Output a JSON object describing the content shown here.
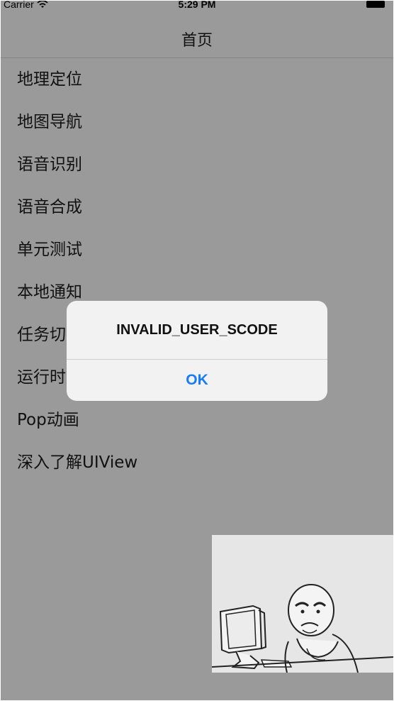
{
  "status_bar": {
    "carrier": "Carrier",
    "time": "5:29 PM",
    "wifi_icon": "wifi-icon",
    "battery_icon": "battery-icon"
  },
  "nav": {
    "title": "首页"
  },
  "menu": {
    "items": [
      {
        "label": "地理定位"
      },
      {
        "label": "地图导航"
      },
      {
        "label": "语音识别"
      },
      {
        "label": "语音合成"
      },
      {
        "label": "单元测试"
      },
      {
        "label": "本地通知"
      },
      {
        "label": "任务切换"
      },
      {
        "label": "运行时"
      },
      {
        "label": "Pop动画"
      },
      {
        "label": "深入了解UIView"
      }
    ]
  },
  "alert": {
    "title": "INVALID_USER_SCODE",
    "ok_label": "OK"
  },
  "overlay": {
    "description_icon": "meme-computer-guy-image"
  },
  "colors": {
    "background_dim": "#9a9a9a",
    "alert_background": "#f2f2f2",
    "button_blue": "#1a7cf5"
  }
}
